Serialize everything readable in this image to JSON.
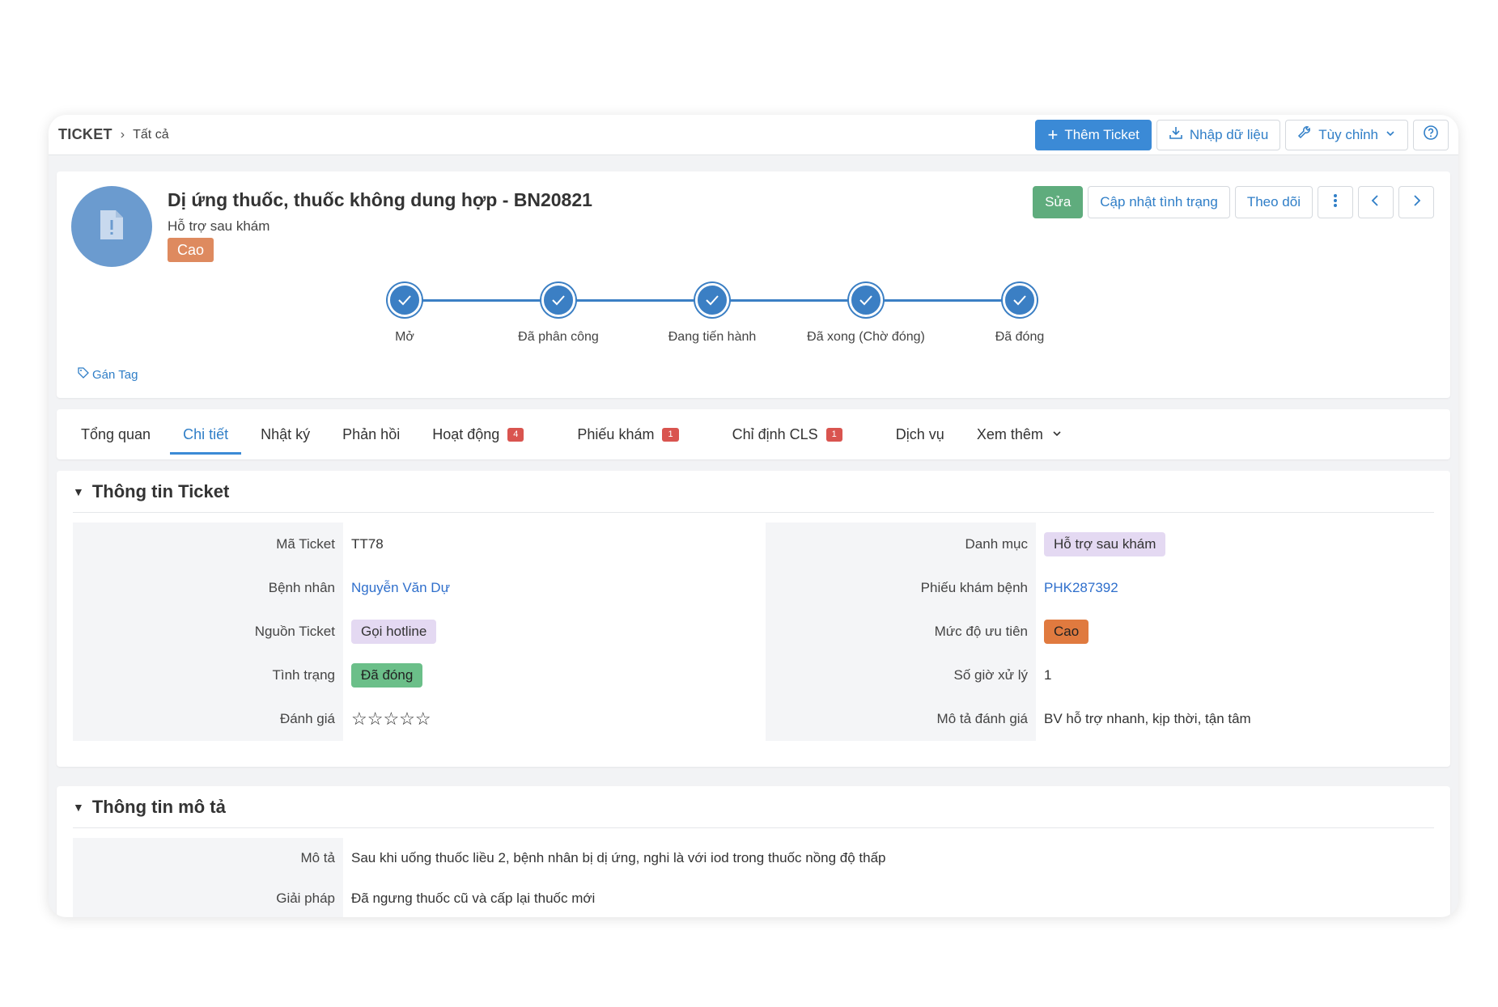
{
  "topbar": {
    "breadcrumb_root": "TICKET",
    "breadcrumb_current": "Tất cả",
    "add_ticket_label": "Thêm Ticket",
    "import_label": "Nhập dữ liệu",
    "customize_label": "Tùy chỉnh"
  },
  "ticket": {
    "title": "Dị ứng thuốc, thuốc không dung hợp - BN20821",
    "category": "Hỗ trợ sau khám",
    "priority": "Cao",
    "tag_label": "Gán Tag"
  },
  "actions": {
    "edit_label": "Sửa",
    "update_status_label": "Cập nhật tình trạng",
    "follow_label": "Theo dõi"
  },
  "steps": [
    {
      "label": "Mở"
    },
    {
      "label": "Đã phân công"
    },
    {
      "label": "Đang tiến hành"
    },
    {
      "label": "Đã xong (Chờ đóng)"
    },
    {
      "label": "Đã đóng"
    }
  ],
  "tabs": [
    {
      "label": "Tổng quan"
    },
    {
      "label": "Chi tiết"
    },
    {
      "label": "Nhật ký"
    },
    {
      "label": "Phản hồi"
    },
    {
      "label": "Hoạt động",
      "count": "4"
    },
    {
      "label": "Phiếu khám",
      "count": "1"
    },
    {
      "label": "Chỉ định CLS",
      "count": "1"
    },
    {
      "label": "Dịch vụ"
    },
    {
      "label": "Xem thêm"
    }
  ],
  "ticket_info": {
    "section_title": "Thông tin Ticket",
    "left": {
      "labels": [
        "Mã Ticket",
        "Bệnh nhân",
        "Nguồn Ticket",
        "Tình trạng",
        "Đánh giá"
      ],
      "code": "TT78",
      "patient": "Nguyễn Văn Dự",
      "source": "Gọi hotline",
      "status": "Đã đóng",
      "rating_stars": "☆☆☆☆☆"
    },
    "right": {
      "labels": [
        "Danh mục",
        "Phiếu khám bệnh",
        "Mức độ ưu tiên",
        "Số giờ xử lý",
        "Mô tả đánh giá"
      ],
      "category": "Hỗ trợ sau khám",
      "exam_form": "PHK287392",
      "priority": "Cao",
      "hours": "1",
      "rating_desc": "BV hỗ trợ nhanh, kịp thời, tận tâm"
    }
  },
  "description_info": {
    "section_title": "Thông tin mô tả",
    "labels": [
      "Mô tả",
      "Giải pháp"
    ],
    "description": "Sau khi uống thuốc liều 2, bệnh nhân bị dị ứng, nghi là với iod trong thuốc nồng độ thấp",
    "solution": "Đã ngưng thuốc cũ và cấp lại thuốc mới"
  },
  "colors": {
    "primary": "#3b8ad6",
    "success": "#5fac7d",
    "priority_high": "#e07a3f",
    "status_closed": "#6bbf89",
    "category_pill": "#e4d9f2",
    "count_badge": "#d9544f"
  }
}
